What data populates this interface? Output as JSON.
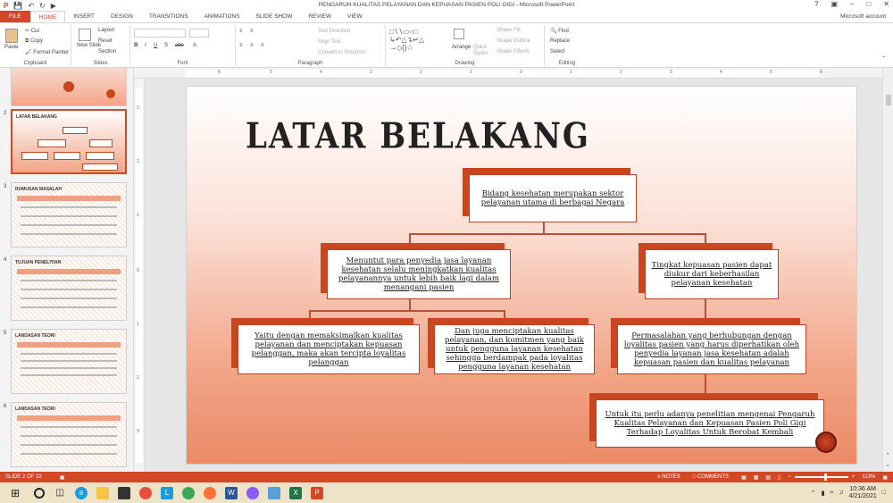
{
  "window": {
    "title": "PENGARUH KUALITAS PELAYANAN DAN KEPUASAN PASIEN POLI GIGI - Microsoft PowerPoint",
    "account": "Microsoft account"
  },
  "tabs": [
    "FILE",
    "HOME",
    "INSERT",
    "DESIGN",
    "TRANSITIONS",
    "ANIMATIONS",
    "SLIDE SHOW",
    "REVIEW",
    "VIEW"
  ],
  "ribbon": {
    "clipboard": {
      "paste": "Paste",
      "cut": "Cut",
      "copy": "Copy",
      "format_painter": "Format Painter",
      "label": "Clipboard"
    },
    "slides": {
      "new_slide": "New Slide",
      "layout": "Layout",
      "reset": "Reset",
      "section": "Section",
      "label": "Slides"
    },
    "font": {
      "label": "Font"
    },
    "paragraph": {
      "text_direction": "Text Direction",
      "align_text": "Align Text",
      "convert": "Convert to SmartArt",
      "label": "Paragraph"
    },
    "drawing": {
      "arrange": "Arrange",
      "quick_styles": "Quick Styles",
      "shape_fill": "Shape Fill",
      "shape_outline": "Shape Outline",
      "shape_effects": "Shape Effects",
      "label": "Drawing"
    },
    "editing": {
      "find": "Find",
      "replace": "Replace",
      "select": "Select",
      "label": "Editing"
    }
  },
  "ruler": {
    "h_ticks": [
      "6",
      "5",
      "4",
      "3",
      "2",
      "1",
      "0",
      "1",
      "2",
      "3",
      "4",
      "5",
      "6"
    ],
    "v_ticks": [
      "3",
      "2",
      "1",
      "0",
      "1",
      "2",
      "3"
    ]
  },
  "thumbnails": [
    {
      "num": "2",
      "title": "LATAR BELAKANG"
    },
    {
      "num": "3",
      "title": "RUMUSAN MASALAH"
    },
    {
      "num": "4",
      "title": "TUJUAN PENELITIAN"
    },
    {
      "num": "5",
      "title": "LANDASAN TEORI"
    },
    {
      "num": "6",
      "title": "LANDASAN TEORI"
    }
  ],
  "slide": {
    "title": "LATAR BELAKANG",
    "boxes": {
      "top": "Bidang kesehatan merupakan sektor pelayanan utama di berbagai Negara",
      "mid_left": "Menuntut para penyedia jasa layanan kesehatan selalu meningkatkan kualitas pelayanannya untuk lebih baik lagi dalam menangani pasien",
      "mid_right": "Tingkat kepuasan pasien dapat diukur dari keberhasilan pelayanan kesehatan",
      "low_1": "Yaitu dengan memaksimalkan kualitas pelayanan dan menciptakan kepuasan pelanggan, maka akan tercipta loyalitas pelanggan",
      "low_2": "Dan juga menciptakan kualitas pelayanan, dan komitmen yang baik untuk pengguna layanan kesehatan sehingga berdampak pada loyalitas pengguna layanan kesehatan",
      "low_3": "Permasalahan yang berhubungan dengan loyalitas pasien yang harus diperhatikan oleh penyedia layanan jasa kesehatan adalah kepuasan pasien dan kualitas pelayanan",
      "bottom": "Untuk itu perlu adanya penelitian mengenai Pengaruh Kualitas Pelayanan dan Kepuasan Pasien Poli Gigi Terhadap Loyalitas Untuk Berobat Kembali"
    }
  },
  "status": {
    "slide": "SLIDE 2 OF 22",
    "notes": "NOTES",
    "comments": "COMMENTS",
    "zoom": "113%"
  },
  "taskbar": {
    "time": "10:36 AM",
    "date": "4/21/2021"
  },
  "colors": {
    "accent": "#d24726"
  }
}
